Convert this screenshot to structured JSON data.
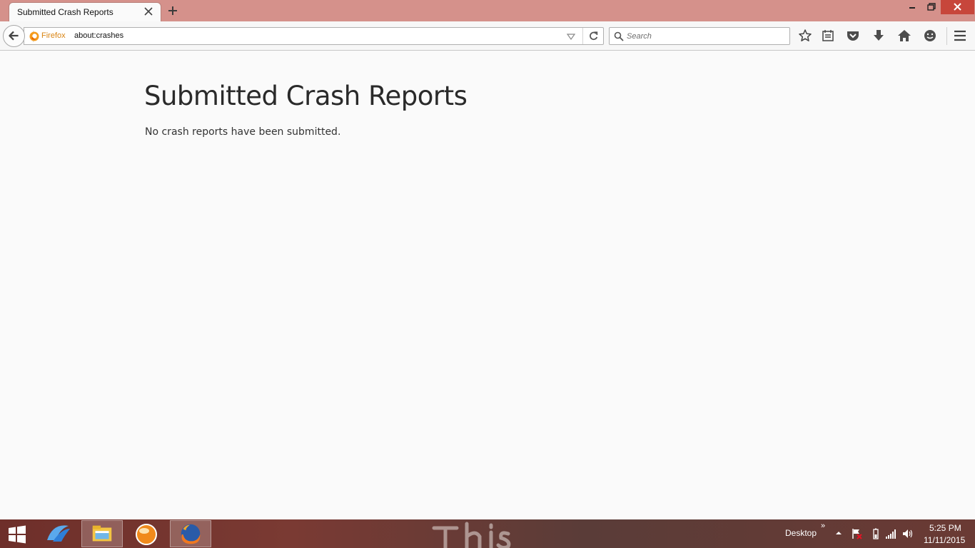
{
  "browser": {
    "tab": {
      "title": "Submitted Crash Reports"
    },
    "identity_label": "Firefox",
    "url": "about:crashes",
    "search_placeholder": "Search",
    "icons": [
      "back-icon",
      "firefox-icon",
      "dropdown-icon",
      "reload-icon",
      "search-icon",
      "bookmark-star-icon",
      "reading-list-icon",
      "pocket-icon",
      "download-icon",
      "home-icon",
      "hello-icon",
      "menu-icon"
    ]
  },
  "page": {
    "title": "Submitted Crash Reports",
    "message": "No crash reports have been submitted."
  },
  "taskbar": {
    "desktop_label": "Desktop",
    "chevron": "»",
    "time": "5:25 PM",
    "date": "11/11/2015",
    "apps": [
      "internet-explorer-icon",
      "file-explorer-icon",
      "globe-app-icon",
      "firefox-icon"
    ]
  },
  "colors": {
    "titlebar": "#d5918b",
    "close_button": "#c7463b",
    "page_background": "#fafafa",
    "identity_label": "#d98412"
  }
}
